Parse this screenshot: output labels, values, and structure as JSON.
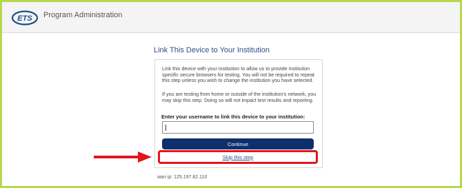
{
  "header": {
    "logo_text": "ETS",
    "title": "Program Administration"
  },
  "main": {
    "page_title": "Link This Device to Your Institution",
    "paragraph1": "Link this device with your institution to allow us to provide institution specific secure browsers for testing. You will not be required to repeat this step unless you wish to change the institution you have selected.",
    "paragraph2": "If you are testing from home or outside of the institution's network, you may skip this step. Doing so will not impact test results and reporting.",
    "prompt": "Enter your username to link this device to your institution:",
    "username_value": "",
    "continue_label": "Continue",
    "skip_label": "Skip this step"
  },
  "footer": {
    "wan_ip": "wan ip:  125.197.82.110"
  },
  "colors": {
    "frame": "#b7d84b",
    "button": "#0e2f6b",
    "highlight": "#e3151d",
    "link": "#2d4e86"
  }
}
